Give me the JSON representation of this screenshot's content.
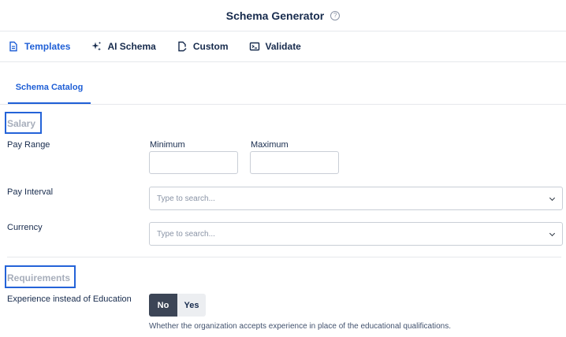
{
  "header": {
    "title": "Schema Generator",
    "help_icon": "help-circle-icon",
    "help_glyph": "?"
  },
  "tabs": [
    {
      "label": "Templates",
      "icon": "document-icon",
      "active": true
    },
    {
      "label": "AI Schema",
      "icon": "sparkle-icon",
      "active": false
    },
    {
      "label": "Custom",
      "icon": "file-edit-icon",
      "active": false
    },
    {
      "label": "Validate",
      "icon": "terminal-icon",
      "active": false
    }
  ],
  "subtabs": [
    {
      "label": "Schema Catalog",
      "active": true
    }
  ],
  "salary": {
    "title": "Salary",
    "pay_range": {
      "label": "Pay Range",
      "min_label": "Minimum",
      "max_label": "Maximum",
      "min_value": "",
      "max_value": ""
    },
    "pay_interval": {
      "label": "Pay Interval",
      "placeholder": "Type to search..."
    },
    "currency": {
      "label": "Currency",
      "placeholder": "Type to search..."
    }
  },
  "requirements": {
    "title": "Requirements",
    "experience": {
      "label": "Experience instead of Education",
      "options": [
        "No",
        "Yes"
      ],
      "selected": "No",
      "help": "Whether the organization accepts experience in place of the educational qualifications."
    }
  },
  "colors": {
    "accent": "#1f5fd6",
    "highlight_box": "#2463d8",
    "toggle_on": "#3c4556",
    "muted_title": "#a7aebb"
  }
}
